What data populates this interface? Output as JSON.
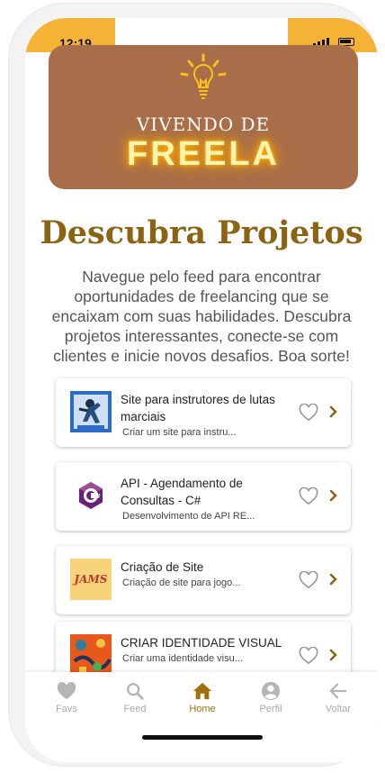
{
  "status": {
    "time": "12:19"
  },
  "banner": {
    "line1": "VIVENDO DE",
    "line2": "FREELA"
  },
  "page": {
    "title": "Descubra Projetos",
    "description": "Navegue pelo feed para encontrar oportunidades de freelancing que se encaixam com suas habilidades. Descubra projetos interessantes, conecte-se com clientes e inicie novos desafios. Boa sorte!"
  },
  "projects": [
    {
      "title": "Site para instrutores de lutas marciais",
      "subtitle": "Criar um site para instru...",
      "thumb_icon": "martial-arts-thumbnail"
    },
    {
      "title": "API - Agendamento de Consultas - C#",
      "subtitle": "Desenvolvimento de API RE...",
      "thumb_icon": "csharp-logo"
    },
    {
      "title": "Criação de Site",
      "subtitle": "Criação de site para jogo...",
      "thumb_icon": "jams-thumbnail",
      "thumb_text": "JAMS"
    },
    {
      "title": "CRIAR IDENTIDADE VISUAL",
      "subtitle": "Criar uma identidade visu...",
      "thumb_icon": "illustration-thumbnail"
    }
  ],
  "tabs": [
    {
      "label": "Favs",
      "icon": "heart-icon"
    },
    {
      "label": "Feed",
      "icon": "search-icon"
    },
    {
      "label": "Home",
      "icon": "home-icon",
      "active": true
    },
    {
      "label": "Perfil",
      "icon": "user-icon"
    },
    {
      "label": "Voltar",
      "icon": "arrow-left-icon"
    }
  ],
  "colors": {
    "accent": "#f5b335",
    "banner": "#a86e49",
    "title": "#8c6313",
    "active_tab": "#a46f09"
  }
}
